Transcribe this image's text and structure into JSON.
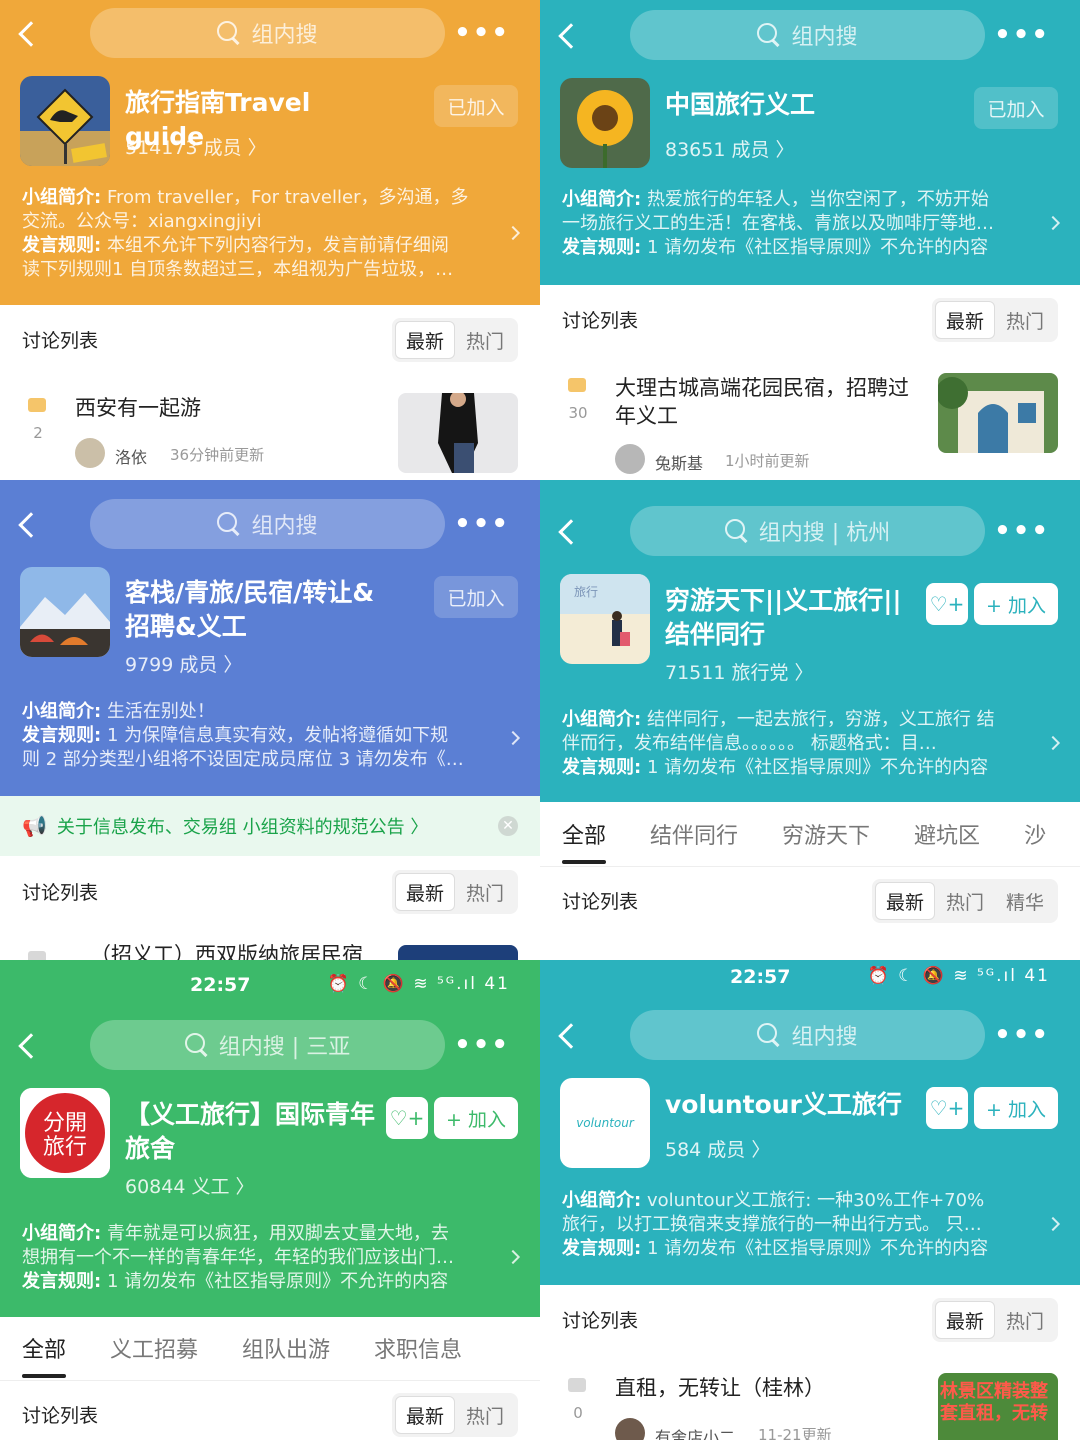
{
  "common": {
    "search_placeholder": "组内搜",
    "more": "•••",
    "joined_label": "已加入",
    "join_label": "+ 加入",
    "intro_prefix": "小组简介:",
    "rules_prefix": "发言规则:",
    "discussion_title": "讨论列表",
    "sort_latest": "最新",
    "sort_hot": "热门",
    "sort_featured": "精华",
    "follow_icon": "♡+"
  },
  "p1": {
    "name": "旅行指南Travel guide",
    "count": "514173 成员 〉",
    "intro": "From traveller, For traveller, 多沟通, 多交流。公众号: xiangxingjiyi",
    "intro_line1": "From traveller，For traveller，多沟通，多",
    "intro_line2": "交流。公众号：xiangxingjiyi",
    "rules_line1": "本组不允许下列内容行为，发言前请仔细阅",
    "rules_line2": "读下列规则1 自顶条数超过三，本组视为广告垃圾，…",
    "post": {
      "count": "2",
      "title": "西安有一起游",
      "author": "洛依",
      "time": "36分钟前更新"
    },
    "color": "#f0a83a"
  },
  "p2": {
    "name": "中国旅行义工",
    "count": "83651 成员 〉",
    "intro_line1": "热爱旅行的年轻人，当你空闲了，不妨开始",
    "intro_line2": "一场旅行义工的生活！在客栈、青旅以及咖啡厅等地…",
    "rules_line1": "1 请勿发布《社区指导原则》不允许的内容",
    "post": {
      "count": "30",
      "title": "大理古城高端花园民宿，招聘过年义工",
      "author": "兔斯基",
      "time": "1小时前更新"
    },
    "color": "#2bb2bd"
  },
  "p3": {
    "name": "客栈/青旅/民宿/转让&招聘&义工",
    "count": "9799 成员 〉",
    "intro_line1": "生活在别处！",
    "rules_line1": "1 为保障信息真实有效，发帖将遵循如下规",
    "rules_line2": "则 2 部分类型小组将不设固定成员席位 3 请勿发布《…",
    "notice": "关于信息发布、交易组 小组资料的规范公告 〉",
    "post_title": "（招义工）西双版纳旅居民宿",
    "color": "#5b7fd4"
  },
  "p4": {
    "search": "组内搜 | 杭州",
    "name": "穷游天下||义工旅行||结伴同行",
    "count": "71511 旅行党 〉",
    "intro_line1": "结伴同行，一起去旅行，穷游，义工旅行 结",
    "intro_line2": "伴而行，发布结伴信息。。。。。。 标题格式：目…",
    "rules_line1": "1 请勿发布《社区指导原则》不允许的内容",
    "tabs": [
      "全部",
      "结伴同行",
      "穷游天下",
      "避坑区",
      "沙"
    ],
    "color": "#2bb2bd"
  },
  "p5": {
    "time": "22:57",
    "status_icons": "⏰ ☾ 🔕 ≋ ⁵ᴳ.ıl 41",
    "search": "组内搜 | 三亚",
    "name": "【义工旅行】国际青年旅舍",
    "count": "60844 义工 〉",
    "intro_line1": "青年就是可以疯狂，用双脚去丈量大地，去",
    "intro_line2": "想拥有一个不一样的青春年华，年轻的我们应该出门…",
    "rules_line1": "1 请勿发布《社区指导原则》不允许的内容",
    "tabs": [
      "全部",
      "义工招募",
      "组队出游",
      "求职信息"
    ],
    "color": "#3cba6a"
  },
  "p6": {
    "time": "22:57",
    "status_icons": "⏰ ☾ 🔕 ≋ ⁵ᴳ.ıl 41",
    "name": "voluntour义工旅行",
    "count": "584 成员 〉",
    "avatar_text": "voluntour",
    "intro_line1": "voluntour义工旅行:    一种30%工作+70%",
    "intro_line2": "旅行，以打工换宿来支撑旅行的一种出行方式。 只…",
    "rules_line1": "1 请勿发布《社区指导原则》不允许的内容",
    "post": {
      "count": "0",
      "title": "直租，无转让（桂林）",
      "author": "有舍店小二",
      "time": "11-21更新",
      "thumb_text": "林景区精装整套直租，无转"
    },
    "color": "#2bb2bd"
  }
}
